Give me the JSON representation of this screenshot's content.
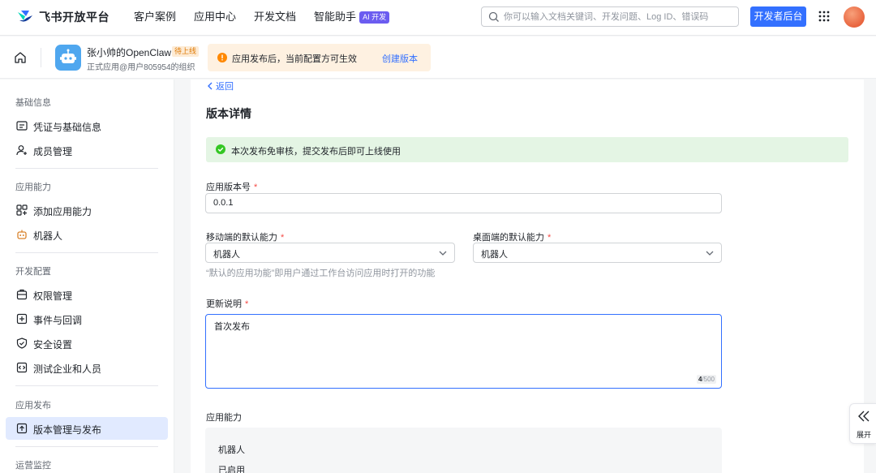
{
  "brand": {
    "name": "飞书开放平台"
  },
  "nav": {
    "items": [
      "客户案例",
      "应用中心",
      "开发文档",
      "智能助手"
    ],
    "ai_badge": "AI 开发",
    "search_placeholder": "你可以输入文档关键词、开发问题、Log ID、错误码",
    "dev_console": "开发者后台"
  },
  "app": {
    "name": "张小帅的OpenClaw",
    "status": "待上线",
    "org": "正式应用@用户805954的组织"
  },
  "notice": {
    "text": "应用发布后，当前配置方可生效",
    "action": "创建版本"
  },
  "sidebar": {
    "groups": [
      {
        "title": "基础信息",
        "items": [
          {
            "label": "凭证与基础信息",
            "icon": "credential-icon"
          },
          {
            "label": "成员管理",
            "icon": "member-icon"
          }
        ]
      },
      {
        "title": "应用能力",
        "items": [
          {
            "label": "添加应用能力",
            "icon": "add-capability-icon"
          },
          {
            "label": "机器人",
            "icon": "robot-icon"
          }
        ]
      },
      {
        "title": "开发配置",
        "items": [
          {
            "label": "权限管理",
            "icon": "permission-icon"
          },
          {
            "label": "事件与回调",
            "icon": "event-icon"
          },
          {
            "label": "安全设置",
            "icon": "shield-icon"
          },
          {
            "label": "测试企业和人员",
            "icon": "test-icon"
          }
        ]
      },
      {
        "title": "应用发布",
        "items": [
          {
            "label": "版本管理与发布",
            "icon": "publish-icon",
            "active": true
          }
        ]
      },
      {
        "title": "运营监控",
        "items": []
      }
    ]
  },
  "content": {
    "back": "返回",
    "title": "版本详情",
    "success": "本次发布免审核，提交发布后即可上线使用",
    "version_label": "应用版本号",
    "version_value": "0.0.1",
    "mobile_label": "移动端的默认能力",
    "mobile_value": "机器人",
    "desktop_label": "桌面端的默认能力",
    "desktop_value": "机器人",
    "hint": "“默认的应用功能”即用户通过工作台访问应用时打开的功能",
    "notes_label": "更新说明",
    "notes_value": "首次发布",
    "counter_current": "4",
    "counter_max": "/500",
    "capability_title": "应用能力",
    "capability_name": "机器人",
    "capability_status": "已启用",
    "required_mark": "*"
  },
  "expand": {
    "label": "展开"
  },
  "colors": {
    "accent": "#3370ff",
    "active_bg": "#e1eaff",
    "success_bg": "#e4f5e4",
    "notice_bg": "#fef1e1",
    "required": "#f54a45"
  }
}
